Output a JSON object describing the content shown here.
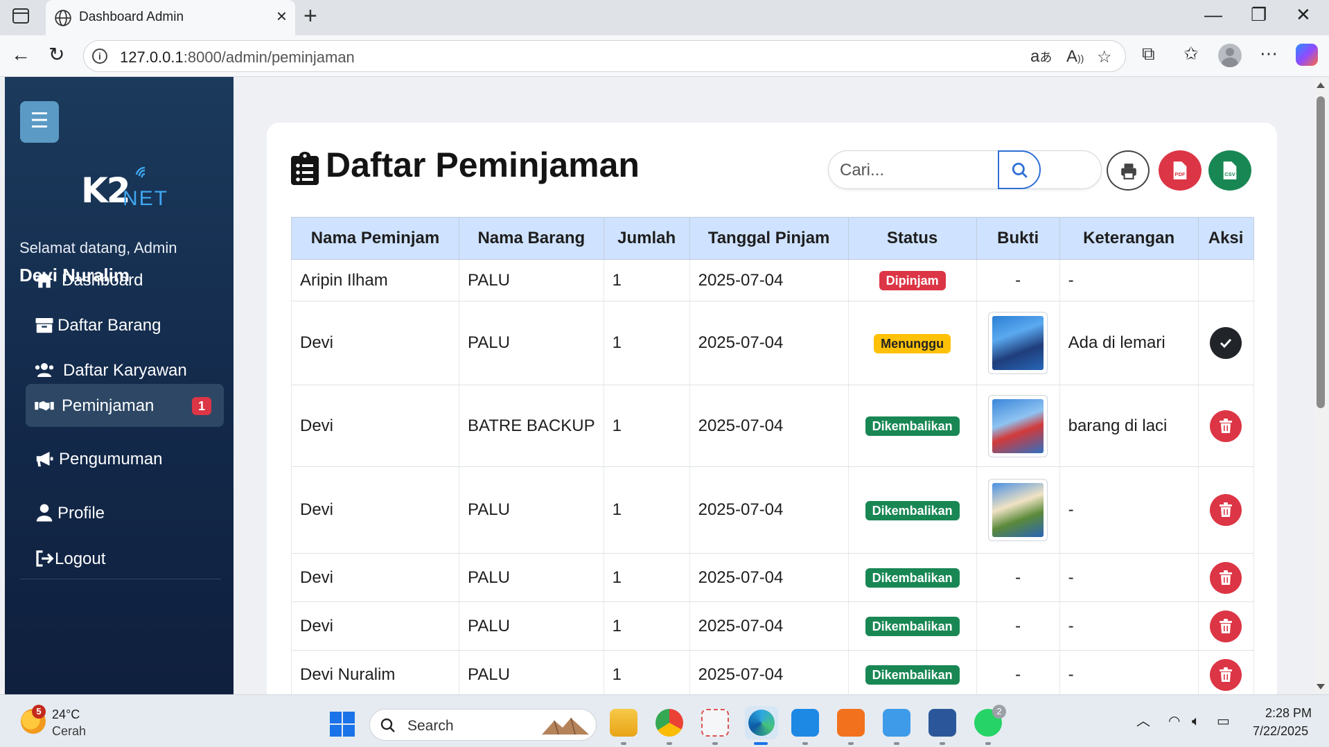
{
  "browser": {
    "tab_title": "Dashboard Admin",
    "url_host": "127.0.0.1",
    "url_rest": ":8000/admin/peminjaman"
  },
  "sidebar": {
    "logo_main": "K2",
    "logo_sub": "NET",
    "welcome": "Selamat datang, Admin",
    "username": "Devi Nuralim",
    "items": [
      {
        "label": "Dashboard",
        "icon": "home-icon"
      },
      {
        "label": "Daftar Barang",
        "icon": "box-icon"
      },
      {
        "label": "Daftar Karyawan",
        "icon": "users-icon"
      },
      {
        "label": "Peminjaman",
        "icon": "handshake-icon",
        "badge": "1",
        "active": true
      },
      {
        "label": "Pengumuman",
        "icon": "megaphone-icon"
      },
      {
        "label": "Profile",
        "icon": "user-icon"
      },
      {
        "label": "Logout",
        "icon": "logout-icon"
      }
    ]
  },
  "main": {
    "title": "Daftar Peminjaman",
    "search_placeholder": "Cari...",
    "export_pdf": "PDF",
    "export_csv": "CSV"
  },
  "table": {
    "headers": [
      "Nama Peminjam",
      "Nama Barang",
      "Jumlah",
      "Tanggal Pinjam",
      "Status",
      "Bukti",
      "Keterangan",
      "Aksi"
    ],
    "rows": [
      {
        "nama": "Aripin Ilham",
        "barang": "PALU",
        "jumlah": "1",
        "tanggal": "2025-07-04",
        "status": "Dipinjam",
        "bukti": "-",
        "keterangan": "-",
        "aksi": ""
      },
      {
        "nama": "Devi",
        "barang": "PALU",
        "jumlah": "1",
        "tanggal": "2025-07-04",
        "status": "Menunggu",
        "bukti": "image",
        "keterangan": "Ada di lemari",
        "aksi": "approve"
      },
      {
        "nama": "Devi",
        "barang": "BATRE BACKUP",
        "jumlah": "1",
        "tanggal": "2025-07-04",
        "status": "Dikembalikan",
        "bukti": "image",
        "keterangan": "barang di laci",
        "aksi": "delete"
      },
      {
        "nama": "Devi",
        "barang": "PALU",
        "jumlah": "1",
        "tanggal": "2025-07-04",
        "status": "Dikembalikan",
        "bukti": "image",
        "keterangan": "-",
        "aksi": "delete"
      },
      {
        "nama": "Devi",
        "barang": "PALU",
        "jumlah": "1",
        "tanggal": "2025-07-04",
        "status": "Dikembalikan",
        "bukti": "-",
        "keterangan": "-",
        "aksi": "delete"
      },
      {
        "nama": "Devi",
        "barang": "PALU",
        "jumlah": "1",
        "tanggal": "2025-07-04",
        "status": "Dikembalikan",
        "bukti": "-",
        "keterangan": "-",
        "aksi": "delete"
      },
      {
        "nama": "Devi Nuralim",
        "barang": "PALU",
        "jumlah": "1",
        "tanggal": "2025-07-04",
        "status": "Dikembalikan",
        "bukti": "-",
        "keterangan": "-",
        "aksi": "delete"
      }
    ]
  },
  "taskbar": {
    "weather_badge": "5",
    "temperature": "24°C",
    "condition": "Cerah",
    "search_label": "Search",
    "whatsapp_badge": "2",
    "time": "2:28 PM",
    "date": "7/22/2025"
  },
  "colors": {
    "sidebar_top": "#1b3a5c",
    "sidebar_bottom": "#0f1f3d",
    "header_bg": "#cfe2ff",
    "danger": "#dc3545",
    "warning": "#ffc107",
    "success": "#198754",
    "primary": "#2f6fd6"
  }
}
